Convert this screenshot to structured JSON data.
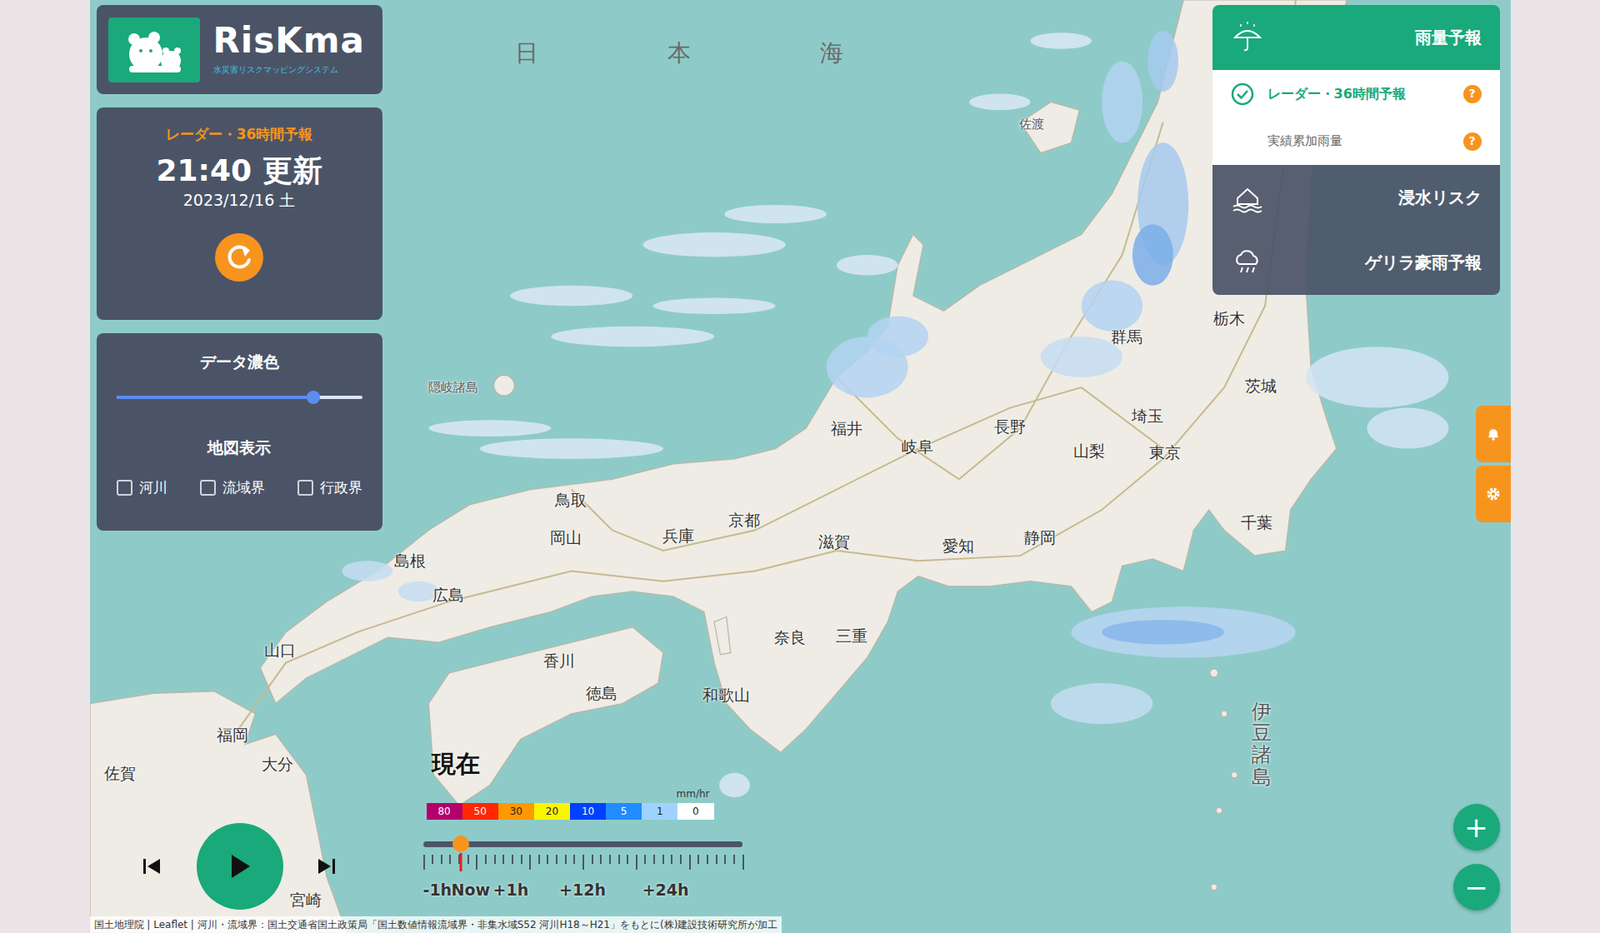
{
  "app": {
    "logo_text": "RisKma",
    "logo_subtitle": "水災害リスクマッピングシステム"
  },
  "update_panel": {
    "title": "レーダー・36時間予報",
    "time": "21:40 更新",
    "date": "2023/12/16 土"
  },
  "display_panel": {
    "opacity_title": "データ濃色",
    "opacity_level": 0.8,
    "map_title": "地図表示",
    "layers": [
      {
        "label": "河川",
        "checked": false
      },
      {
        "label": "流域界",
        "checked": false
      },
      {
        "label": "行政界",
        "checked": false
      }
    ]
  },
  "menu": {
    "header": "雨量予報",
    "options": [
      {
        "label": "レーダー・36時間予報",
        "selected": true,
        "help": "?"
      },
      {
        "label": "実績累加雨量",
        "selected": false,
        "help": "?"
      }
    ],
    "items": [
      {
        "label": "浸水リスク"
      },
      {
        "label": "ゲリラ豪雨予報"
      }
    ]
  },
  "zoom": [
    "+",
    "−"
  ],
  "timeline": {
    "current_label": "現在",
    "unit": "mm/hr",
    "level": 0.12,
    "legend": [
      {
        "value": "80",
        "color": "#b4006e"
      },
      {
        "value": "50",
        "color": "#ff2800"
      },
      {
        "value": "30",
        "color": "#ff9900"
      },
      {
        "value": "20",
        "color": "#faf500"
      },
      {
        "value": "10",
        "color": "#0041ff"
      },
      {
        "value": "5",
        "color": "#218cff"
      },
      {
        "value": "1",
        "color": "#a0d2ff"
      },
      {
        "value": "0",
        "color": "#ffffff"
      }
    ],
    "ticks": [
      "-1h",
      "Now",
      "+1h",
      "+12h",
      "+24h"
    ]
  },
  "map_labels": [
    {
      "text": "日本海",
      "kind": "sea"
    },
    {
      "text": "佐渡",
      "kind": "island"
    },
    {
      "text": "隠岐諸島",
      "kind": "island"
    },
    {
      "text": "福井",
      "kind": "pref"
    },
    {
      "text": "岐阜",
      "kind": "pref"
    },
    {
      "text": "長野",
      "kind": "pref"
    },
    {
      "text": "群馬",
      "kind": "pref"
    },
    {
      "text": "栃木",
      "kind": "pref"
    },
    {
      "text": "茨城",
      "kind": "pref"
    },
    {
      "text": "埼玉",
      "kind": "pref"
    },
    {
      "text": "山梨",
      "kind": "pref"
    },
    {
      "text": "東京",
      "kind": "pref"
    },
    {
      "text": "千葉",
      "kind": "pref"
    },
    {
      "text": "静岡",
      "kind": "pref"
    },
    {
      "text": "愛知",
      "kind": "pref"
    },
    {
      "text": "滋賀",
      "kind": "pref"
    },
    {
      "text": "京都",
      "kind": "pref"
    },
    {
      "text": "兵庫",
      "kind": "pref"
    },
    {
      "text": "鳥取",
      "kind": "pref"
    },
    {
      "text": "岡山",
      "kind": "pref"
    },
    {
      "text": "島根",
      "kind": "pref"
    },
    {
      "text": "広島",
      "kind": "pref"
    },
    {
      "text": "山口",
      "kind": "pref"
    },
    {
      "text": "福岡",
      "kind": "pref"
    },
    {
      "text": "大分",
      "kind": "pref"
    },
    {
      "text": "佐賀",
      "kind": "pref"
    },
    {
      "text": "宮崎",
      "kind": "pref"
    },
    {
      "text": "香川",
      "kind": "pref"
    },
    {
      "text": "徳島",
      "kind": "pref"
    },
    {
      "text": "和歌山",
      "kind": "pref"
    },
    {
      "text": "奈良",
      "kind": "pref"
    },
    {
      "text": "三重",
      "kind": "pref"
    },
    {
      "text": "伊豆諸島",
      "kind": "vertical"
    }
  ],
  "attribution": "国土地理院 | Leaflet | 河川・流域界：国土交通省国土政策局「国土数値情報流域界・非集水域S52 河川H18～H21」をもとに(株)建設技術研究所が加工"
}
